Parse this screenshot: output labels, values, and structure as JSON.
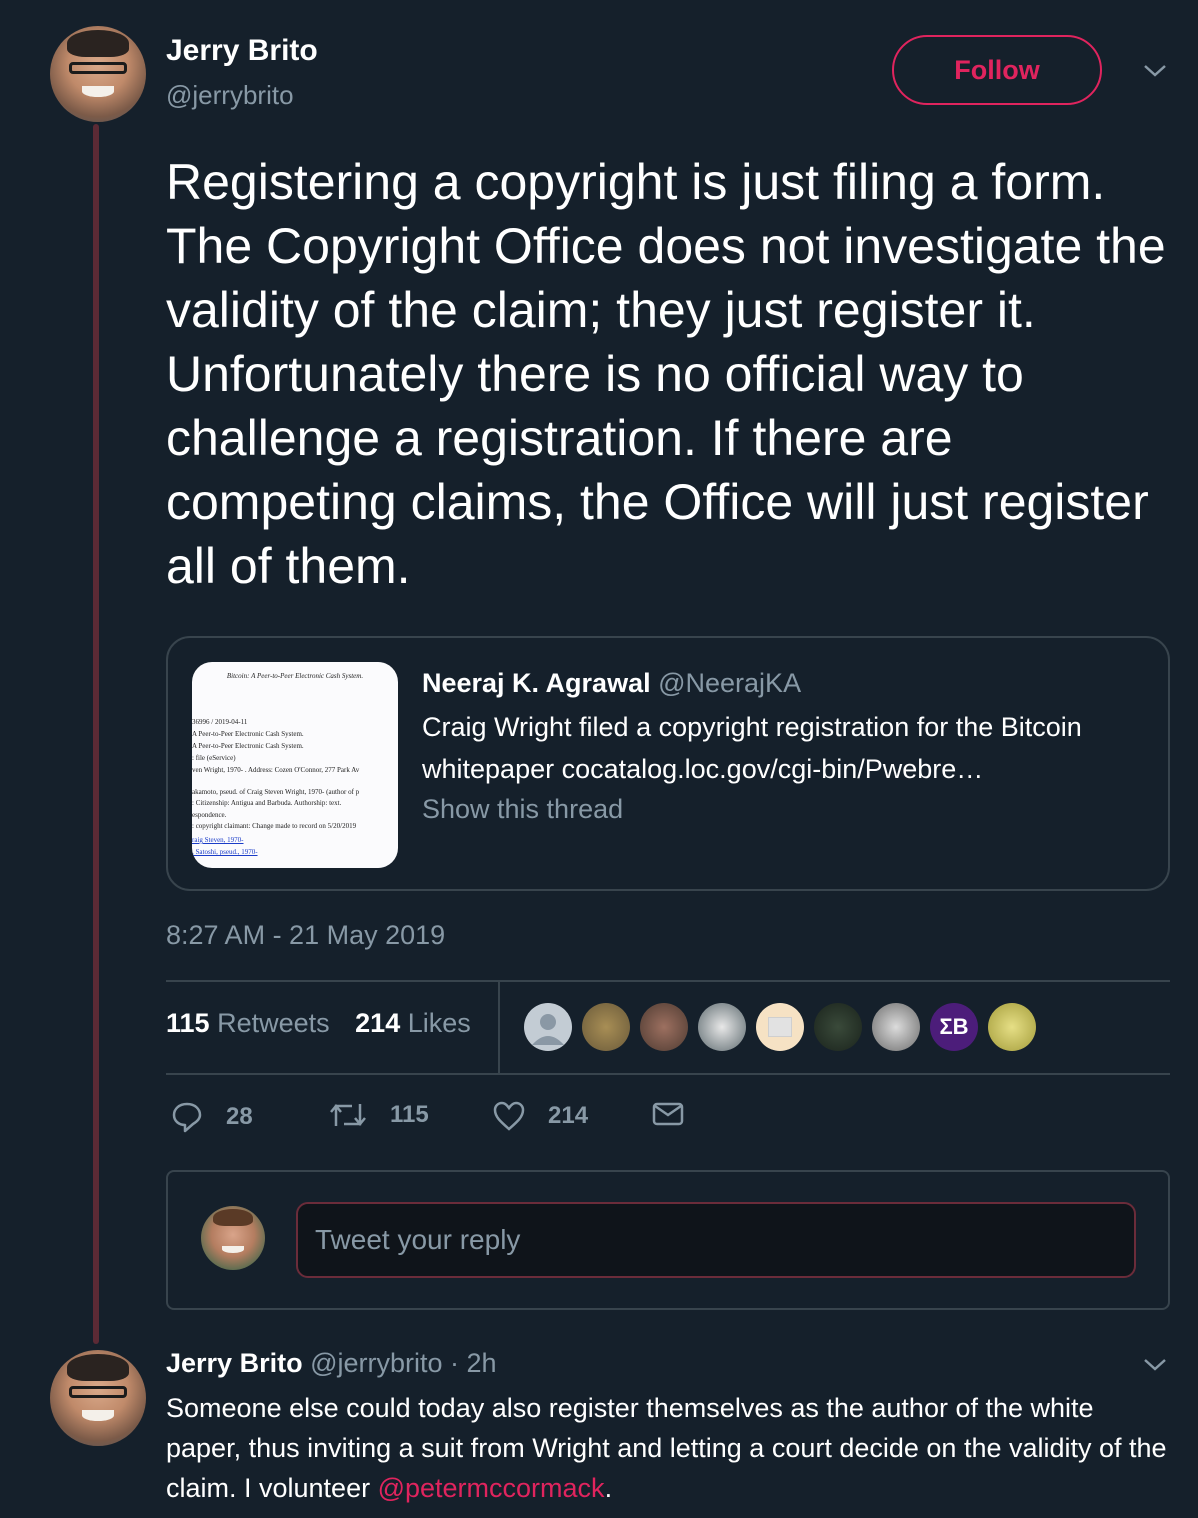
{
  "main_tweet": {
    "author_name": "Jerry Brito",
    "author_handle": "@jerrybrito",
    "follow_label": "Follow",
    "text": "Registering a copyright is just filing a form. The Copyright Office does not investigate the validity of the claim; they just register it. Unfortunately there is no official way to challenge a registration. If there are competing claims, the Office will just register all of them.",
    "timestamp": "8:27 AM - 21 May 2019"
  },
  "quoted_tweet": {
    "author_name": "Neeraj K. Agrawal",
    "author_handle": "@NeerajKA",
    "text": "Craig Wright filed a copyright registration for the Bitcoin whitepaper cocatalog.loc.gov/cgi-bin/Pwebre…",
    "show_thread_label": "Show this thread",
    "thumbnail": {
      "title": "Bitcoin: A Peer-to-Peer Electronic Cash System.",
      "lines": [
        "36996 / 2019-04-11",
        "A Peer-to-Peer Electronic Cash System.",
        "A Peer-to-Peer Electronic Cash System.",
        ": file (eService)",
        "ven Wright, 1970- . Address: Cozen O'Connor, 277 Park Av",
        "akamoto, pseud. of Craig Steven Wright, 1970- (author of p",
        ": Citizenship: Antigua and Barbuda. Authorship: text.",
        "espondence.",
        ": copyright claimant: Change made to record on 5/20/2019"
      ],
      "links": [
        "raig Steven, 1970-",
        ", Satoshi, pseud., 1970-"
      ]
    }
  },
  "stats": {
    "retweets_count": "115",
    "retweets_label": "Retweets",
    "likes_count": "214",
    "likes_label": "Likes"
  },
  "actions": {
    "replies": "28",
    "retweets": "115",
    "likes": "214"
  },
  "reply_composer": {
    "placeholder": "Tweet your reply"
  },
  "reply_tweet": {
    "author_name": "Jerry Brito",
    "author_handle": "@jerrybrito",
    "time": "· 2h",
    "text": "Someone else could today also register themselves as the author of the white paper, thus inviting a suit from Wright and letting a court decide on the validity of the claim.  I volunteer ",
    "mention": "@petermccormack",
    "text_end": "."
  },
  "colors": {
    "background": "#15202b",
    "accent": "#e0245e",
    "muted": "#8899a6",
    "border": "#38444d"
  }
}
